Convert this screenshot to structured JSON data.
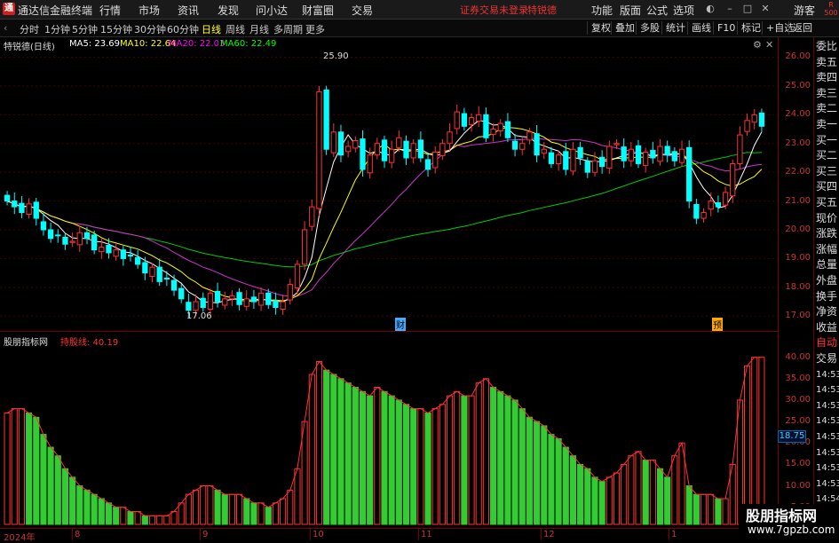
{
  "app": {
    "title": "通达信金融终端",
    "notice": "证券交易未登录",
    "stock_link": "特锐德"
  },
  "menu": [
    "行情",
    "市场",
    "资讯",
    "发现",
    "问小达",
    "财富圈",
    "交易"
  ],
  "right_menu": [
    "功能",
    "版面",
    "公式",
    "选项",
    "游客"
  ],
  "toolbar": {
    "periods": [
      "分时",
      "1分钟",
      "5分钟",
      "15分钟",
      "30分钟",
      "60分钟",
      "日线",
      "周线",
      "月线",
      "多周期",
      "更多"
    ],
    "active": "日线",
    "right": [
      "复权",
      "叠加",
      "多股",
      "统计",
      "画线",
      "F10",
      "标记",
      "+自选",
      "返回"
    ]
  },
  "main_legend": {
    "name": "特锐德(日线)",
    "ma": [
      {
        "label": "MA5: 23.69",
        "color": "#ffffff"
      },
      {
        "label": "MA10: 22.64",
        "color": "#ffff00"
      },
      {
        "label": "MA20: 22.03",
        "color": "#ff00ff"
      },
      {
        "label": "MA60: 22.49",
        "color": "#00ff00"
      }
    ]
  },
  "main_annotations": {
    "high": "25.90",
    "low": "17.06",
    "cai": "财",
    "yu": "预"
  },
  "sub_legend": {
    "name": "股朋指标网",
    "series": "持股线: 40.19",
    "series_color": "#ff3333"
  },
  "right_panel": [
    "委比",
    "卖五",
    "卖四",
    "卖三",
    "卖二",
    "卖一",
    "买一",
    "买二",
    "买三",
    "买四",
    "买五",
    "现价",
    "涨跌",
    "涨幅",
    "总量",
    "外盘",
    "换手",
    "净资",
    "收益",
    "自动",
    "交易",
    "14:53",
    "14:53",
    "14:53",
    "14:53",
    "14:53",
    "14:53",
    "14:53",
    "14:53",
    "14:54"
  ],
  "corner_badge": "R 500",
  "current_marker": "18.75",
  "colors": {
    "up": "#ff3333",
    "down": "#00ffff",
    "ma60": "#00cc00",
    "ma20": "#cc33cc",
    "ma10": "#ffff00",
    "ma5": "#ffffff"
  },
  "watermark": {
    "line1": "股朋指标网",
    "line2": "www.7gpzb.com"
  },
  "chart_data": [
    {
      "type": "candlestick",
      "title": "特锐德(日线)",
      "y_ticks": [
        "26.00",
        "25.00",
        "24.00",
        "23.00",
        "22.00",
        "21.00",
        "20.00",
        "19.00",
        "18.00",
        "17.00"
      ],
      "ylim": [
        16.7,
        26.2
      ],
      "x_ticks": [
        "2024年",
        "8",
        "9",
        "10",
        "11",
        "12",
        "1"
      ],
      "closes": [
        21.0,
        20.8,
        20.6,
        20.9,
        20.4,
        20.0,
        19.7,
        19.8,
        19.5,
        19.6,
        19.9,
        19.7,
        19.3,
        19.4,
        19.2,
        19.3,
        19.0,
        19.1,
        18.8,
        18.5,
        18.7,
        18.2,
        18.3,
        17.9,
        17.6,
        17.2,
        17.5,
        17.3,
        17.8,
        17.5,
        17.6,
        17.7,
        17.4,
        17.6,
        17.5,
        17.8,
        17.4,
        17.3,
        17.5,
        18.1,
        18.8,
        20.0,
        20.8,
        24.8,
        22.8,
        23.4,
        22.6,
        22.9,
        23.1,
        22.1,
        22.6,
        23.0,
        22.4,
        22.8,
        23.2,
        22.5,
        23.0,
        22.5,
        22.1,
        22.7,
        23.0,
        23.4,
        24.1,
        23.6,
        23.9,
        24.0,
        23.2,
        23.5,
        23.7,
        23.2,
        22.8,
        23.0,
        23.4,
        22.6,
        22.8,
        22.3,
        22.6,
        22.1,
        22.8,
        22.5,
        22.0,
        22.4,
        22.2,
        22.9,
        23.0,
        22.4,
        22.8,
        22.3,
        22.7,
        22.5,
        22.9,
        22.6,
        22.4,
        22.8,
        21.0,
        20.4,
        20.6,
        21.0,
        20.8,
        21.3,
        22.3,
        23.3,
        23.8,
        24.0,
        23.6
      ]
    },
    {
      "type": "bar",
      "title": "股朋指标网",
      "series": [
        {
          "name": "持股线",
          "last": 40.19
        }
      ],
      "y_ticks": [
        "40.00",
        "35.00",
        "30.00",
        "25.00",
        "20.00",
        "15.00",
        "10.00",
        "5.00"
      ],
      "ylim": [
        1,
        42
      ],
      "values": [
        27,
        28,
        28,
        27,
        26,
        22,
        19,
        17,
        14,
        12,
        10,
        9,
        8,
        7,
        6,
        5,
        5,
        4,
        4,
        3,
        3,
        3,
        3,
        4,
        6,
        8,
        9,
        10,
        10,
        9,
        8,
        8,
        8,
        7,
        6,
        6,
        5,
        6,
        7,
        9,
        14,
        25,
        36,
        39,
        37,
        36,
        35,
        34,
        33,
        32,
        31,
        33,
        32,
        31,
        30,
        29,
        28,
        28,
        27,
        28,
        29,
        31,
        32,
        31,
        31,
        34,
        35,
        33,
        32,
        31,
        30,
        28,
        26,
        25,
        24,
        22,
        21,
        19,
        17,
        15,
        14,
        12,
        11,
        12,
        13,
        15,
        17,
        18,
        16,
        16,
        14,
        12,
        17,
        20,
        10,
        8,
        8,
        8,
        7,
        7,
        15,
        30,
        38,
        40,
        40
      ]
    }
  ]
}
